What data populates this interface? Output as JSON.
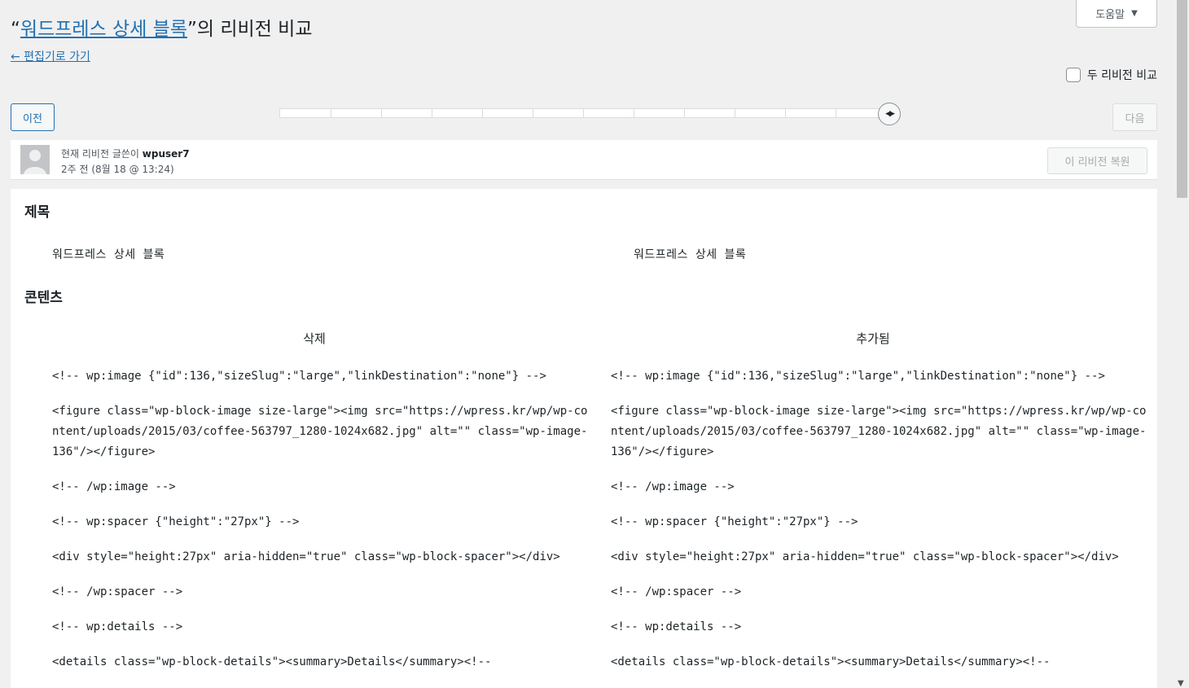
{
  "header": {
    "help_label": "도움말",
    "title_prefix": "“",
    "title_link": "워드프레스 상세 블록",
    "title_suffix": "”의 리비전 비교",
    "back_link": "← 편집기로 가기",
    "compare_two_label": "두 리비전 비교"
  },
  "nav": {
    "prev_label": "이전",
    "next_label": "다음"
  },
  "meta": {
    "author_prefix": "현재 리비전 글쓴이",
    "author_name": "wpuser7",
    "time": "2주 전 (8월 18 @ 13:24)",
    "restore_label": "이 리비전 복원"
  },
  "diff": {
    "title_heading": "제목",
    "title_left": "워드프레스 상세 블록",
    "title_right": "워드프레스 상세 블록",
    "content_heading": "콘텐츠",
    "left_header": "삭제",
    "right_header": "추가됨",
    "code": [
      "<!-- wp:image {\"id\":136,\"sizeSlug\":\"large\",\"linkDestination\":\"none\"} -->",
      "<figure class=\"wp-block-image size-large\"><img src=\"https://wpress.kr/wp/wp-content/uploads/2015/03/coffee-563797_1280-1024x682.jpg\" alt=\"\" class=\"wp-image-136\"/></figure>",
      "<!-- /wp:image -->",
      "<!-- wp:spacer {\"height\":\"27px\"} -->",
      "<div style=\"height:27px\" aria-hidden=\"true\" class=\"wp-block-spacer\"></div>",
      "<!-- /wp:spacer -->",
      "<!-- wp:details -->",
      "<details class=\"wp-block-details\"><summary>Details</summary><!--"
    ]
  }
}
